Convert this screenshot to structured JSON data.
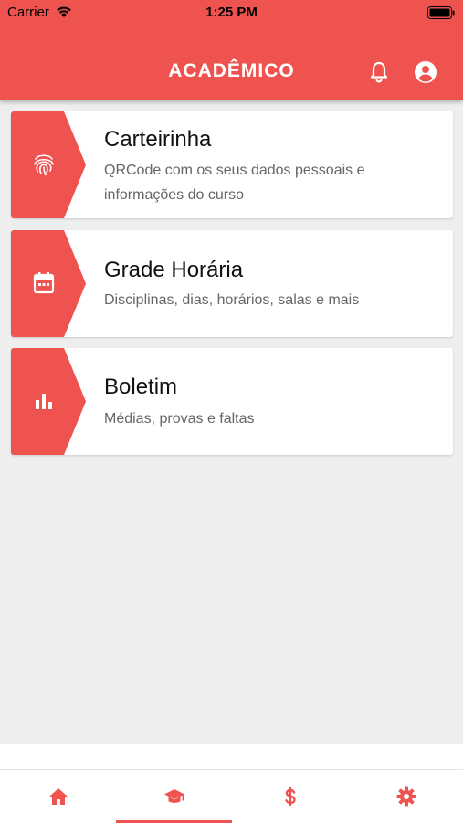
{
  "status_bar": {
    "carrier": "Carrier",
    "time": "1:25 PM"
  },
  "header": {
    "title": "ACADÊMICO",
    "icons": [
      "bell-icon",
      "account-circle-icon"
    ]
  },
  "colors": {
    "accent": "#ef5350",
    "background": "#eeeeee",
    "card": "#ffffff"
  },
  "cards": [
    {
      "icon": "fingerprint-icon",
      "title": "Carteirinha",
      "description": "QRCode com os seus dados pessoais e informações do curso"
    },
    {
      "icon": "calendar-icon",
      "title": "Grade Horária",
      "description": "Disciplinas, dias, horários, salas e mais"
    },
    {
      "icon": "bar-chart-icon",
      "title": "Boletim",
      "description": "Médias, provas e faltas"
    }
  ],
  "bottom_tabs": [
    {
      "icon": "home-icon",
      "selected": false
    },
    {
      "icon": "graduation-cap-icon",
      "selected": true
    },
    {
      "icon": "dollar-icon",
      "selected": false
    },
    {
      "icon": "gear-icon",
      "selected": false
    }
  ]
}
